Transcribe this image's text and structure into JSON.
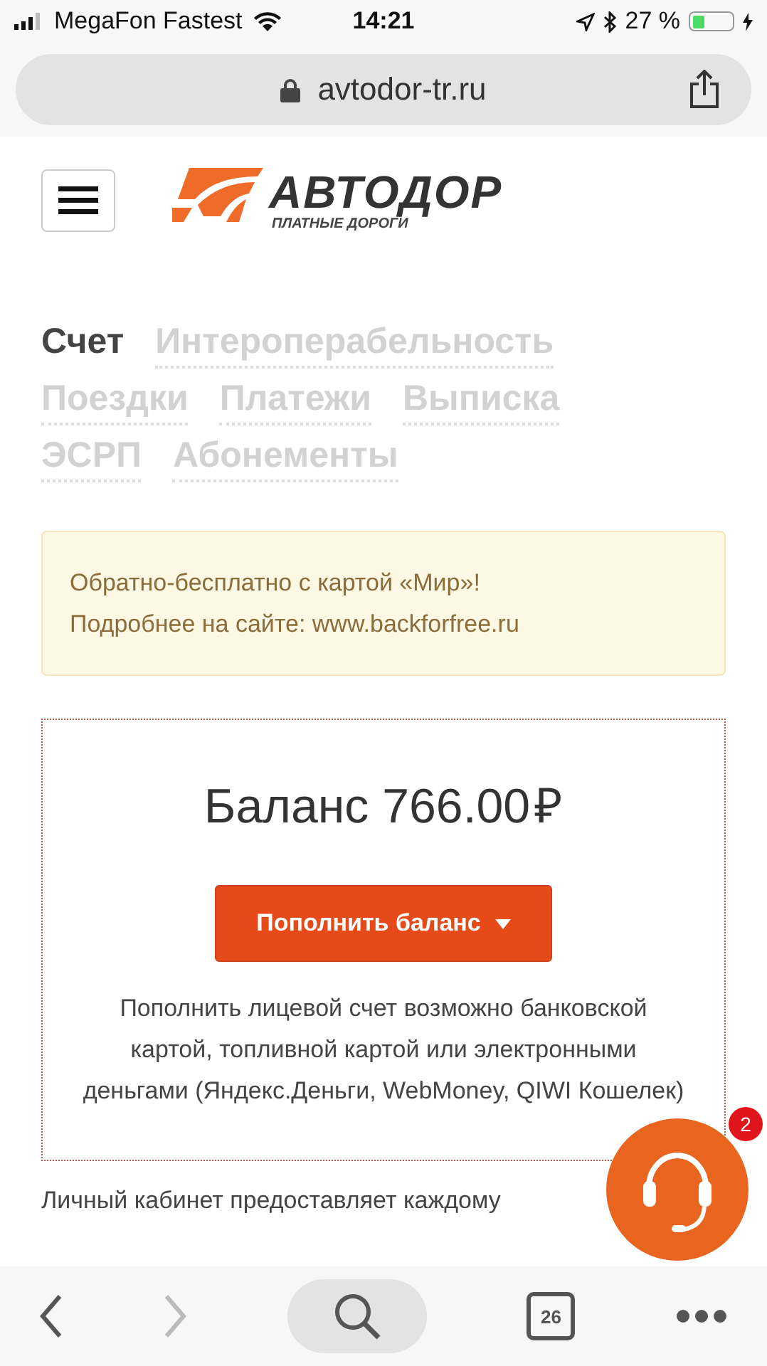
{
  "status_bar": {
    "carrier": "MegaFon Fastest",
    "time": "14:21",
    "battery": "27 %"
  },
  "browser": {
    "url": "avtodor-tr.ru",
    "tab_count": "26"
  },
  "header": {
    "logo_title": "АВТОДОР",
    "logo_subtitle": "ПЛАТНЫЕ ДОРОГИ"
  },
  "tabs": [
    {
      "label": "Счет",
      "selected": true
    },
    {
      "label": "Интероперабельность",
      "selected": false
    },
    {
      "label": "Поездки",
      "selected": false
    },
    {
      "label": "Платежи",
      "selected": false
    },
    {
      "label": "Выписка",
      "selected": false
    },
    {
      "label": "ЭСРП",
      "selected": false
    },
    {
      "label": "Абонементы",
      "selected": false
    }
  ],
  "notice": {
    "lines": [
      "Обратно-бесплатно с картой «Мир»!",
      "Подробнее на сайте: www.backforfree.ru"
    ]
  },
  "balance": {
    "label": "Баланс 766.00",
    "currency": "₽",
    "button": "Пополнить баланс",
    "description": "Пополнить лицевой счет возможно банковской картой, топливной картой или электронными деньгами (Яндекс.Деньги, WebMoney, QIWI Кошелек)"
  },
  "intro": "Личный кабинет предоставляет каждому",
  "chat": {
    "badge": "2"
  }
}
